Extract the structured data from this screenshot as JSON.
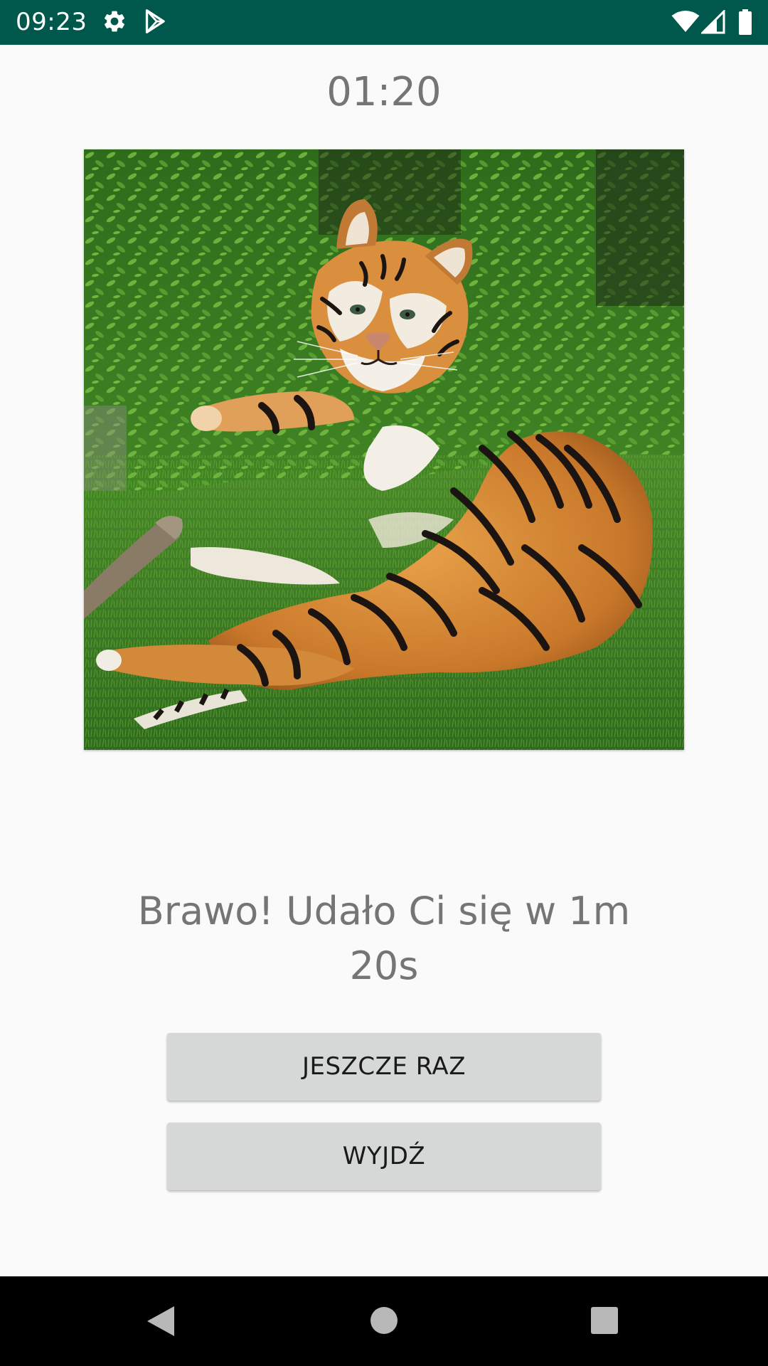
{
  "status_bar": {
    "time": "09:23",
    "icons": [
      "gear-icon",
      "play-store-icon",
      "wifi-icon",
      "signal-icon",
      "battery-icon"
    ]
  },
  "timer": "01:20",
  "image": {
    "subject": "tiger-photo"
  },
  "message": "Brawo! Udało Ci się w 1m 20s",
  "buttons": {
    "again_label": "JESZCZE RAZ",
    "exit_label": "WYJDŹ"
  },
  "nav_bar": {
    "icons": [
      "back-icon",
      "home-icon",
      "recents-icon"
    ]
  },
  "colors": {
    "status_bar": "#00574b",
    "background": "#fafafa",
    "text_gray": "#757575",
    "button_bg": "#d6d7d7"
  }
}
